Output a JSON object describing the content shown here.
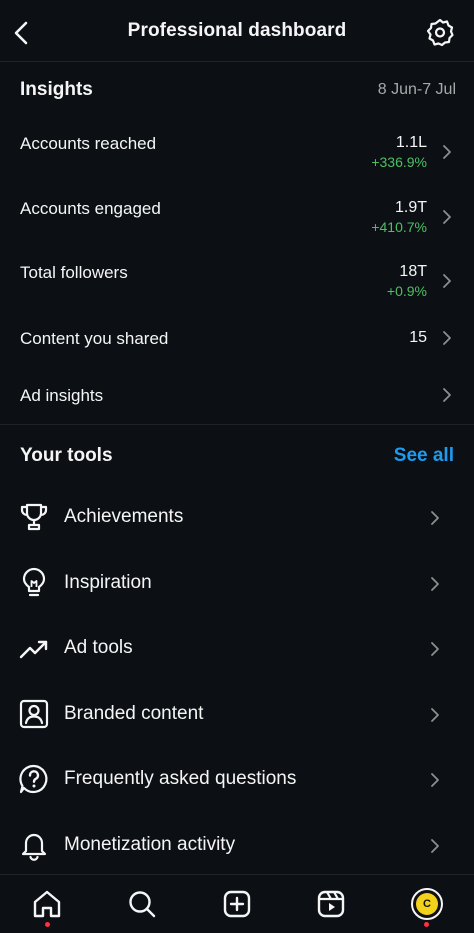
{
  "header": {
    "title": "Professional dashboard"
  },
  "insights": {
    "title": "Insights",
    "date_range": "8 Jun-7 Jul",
    "metrics": [
      {
        "label": "Accounts reached",
        "value": "1.1L",
        "change": "+336.9%"
      },
      {
        "label": "Accounts engaged",
        "value": "1.9T",
        "change": "+410.7%"
      },
      {
        "label": "Total followers",
        "value": "18T",
        "change": "+0.9%"
      },
      {
        "label": "Content you shared",
        "value": "15",
        "change": ""
      },
      {
        "label": "Ad insights",
        "value": "",
        "change": ""
      }
    ]
  },
  "tools": {
    "title": "Your tools",
    "see_all": "See all",
    "items": [
      {
        "label": "Achievements",
        "icon": "trophy-icon"
      },
      {
        "label": "Inspiration",
        "icon": "lightbulb-icon"
      },
      {
        "label": "Ad tools",
        "icon": "trending-up-icon"
      },
      {
        "label": "Branded content",
        "icon": "branded-content-icon"
      },
      {
        "label": "Frequently asked questions",
        "icon": "faq-icon"
      },
      {
        "label": "Monetization activity",
        "icon": "bell-icon"
      }
    ]
  },
  "tabbar": {
    "tabs": [
      "home-icon",
      "search-icon",
      "create-icon",
      "reels-icon",
      "profile-avatar"
    ],
    "avatar_letter": "C"
  },
  "colors": {
    "background": "#0c1014",
    "positive": "#4cc063",
    "link": "#1d9bf0",
    "notification": "#ff3040"
  }
}
